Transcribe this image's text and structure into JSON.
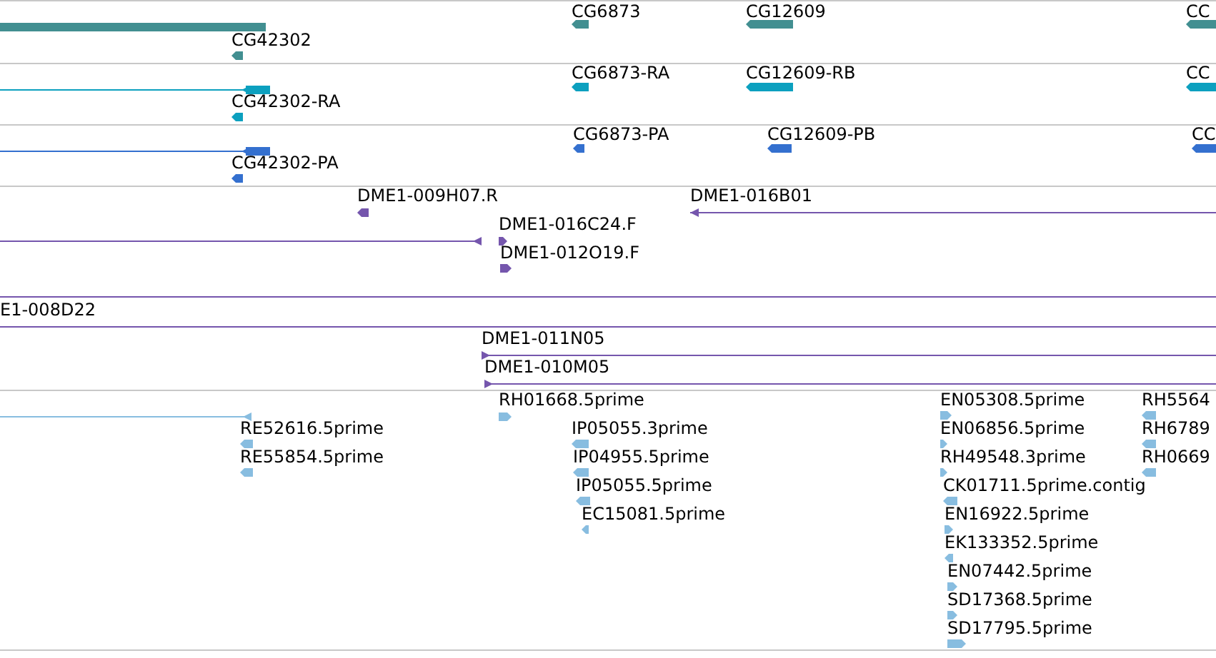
{
  "tracks": [
    {
      "color": "#428f91",
      "features": [
        {
          "kind": "bar"
        },
        {
          "kind": "bar",
          "label": "CG42302",
          "reverse": true
        },
        {
          "kind": "bar",
          "label": "CG6873",
          "reverse": true
        },
        {
          "kind": "bar",
          "label": "CG12609",
          "reverse": true
        },
        {
          "kind": "bar",
          "label": "CC",
          "reverse": true
        }
      ]
    },
    {
      "color": "#0ca0bf",
      "features": [
        {
          "kind": "gene",
          "reverse": true
        },
        {
          "kind": "bar",
          "label": "CG42302-RA",
          "reverse": true
        },
        {
          "kind": "bar",
          "label": "CG6873-RA",
          "reverse": true
        },
        {
          "kind": "bar",
          "label": "CG12609-RB",
          "reverse": true
        },
        {
          "kind": "bar",
          "label": "CC",
          "reverse": true
        }
      ]
    },
    {
      "color": "#3470cf",
      "features": [
        {
          "kind": "gene",
          "reverse": true
        },
        {
          "kind": "bar",
          "label": "CG42302-PA",
          "reverse": true
        },
        {
          "kind": "bar",
          "label": "CG6873-PA",
          "reverse": true
        },
        {
          "kind": "bar",
          "label": "CG12609-PB",
          "reverse": true
        },
        {
          "kind": "bar",
          "label": "CC",
          "reverse": true
        }
      ]
    },
    {
      "color": "#7556ad",
      "features": [
        {
          "kind": "bar",
          "label": "DME1-009H07.R",
          "reverse": true
        },
        {
          "kind": "line",
          "label": "DME1-016B01",
          "reverse": true
        },
        {
          "kind": "line",
          "reverse": true
        },
        {
          "kind": "bar",
          "label": "DME1-016C24.F",
          "reverse": false
        },
        {
          "kind": "bar",
          "label": "DME1-012O19.F",
          "reverse": false
        },
        {
          "kind": "line"
        },
        {
          "kind": "line",
          "label": "E1-008D22"
        },
        {
          "kind": "line",
          "label": "DME1-011N05",
          "reverse": false
        },
        {
          "kind": "line",
          "label": "DME1-010M05",
          "reverse": false
        }
      ]
    },
    {
      "color": "#88bde0",
      "features": [
        {
          "kind": "line",
          "reverse": true
        },
        {
          "kind": "bar",
          "label": "RE52616.5prime",
          "reverse": true
        },
        {
          "kind": "bar",
          "label": "RE55854.5prime",
          "reverse": true
        },
        {
          "kind": "bar",
          "label": "RH01668.5prime",
          "reverse": false
        },
        {
          "kind": "bar",
          "label": "IP05055.3prime",
          "reverse": true
        },
        {
          "kind": "bar",
          "label": "IP04955.5prime",
          "reverse": true
        },
        {
          "kind": "bar",
          "label": "IP05055.5prime",
          "reverse": true
        },
        {
          "kind": "bar",
          "label": "EC15081.5prime",
          "reverse": true
        },
        {
          "kind": "bar",
          "label": "EN05308.5prime",
          "reverse": false
        },
        {
          "kind": "bar",
          "label": "EN06856.5prime",
          "reverse": false
        },
        {
          "kind": "bar",
          "label": "RH49548.3prime",
          "reverse": false
        },
        {
          "kind": "bar",
          "label": "CK01711.5prime.contig",
          "reverse": true
        },
        {
          "kind": "bar",
          "label": "EN16922.5prime",
          "reverse": false
        },
        {
          "kind": "bar",
          "label": "EK133352.5prime",
          "reverse": true
        },
        {
          "kind": "bar",
          "label": "EN07442.5prime",
          "reverse": false
        },
        {
          "kind": "bar",
          "label": "SD17368.5prime",
          "reverse": false
        },
        {
          "kind": "bar",
          "label": "SD17795.5prime",
          "reverse": false
        },
        {
          "kind": "bar",
          "label": "RH5564",
          "reverse": true
        },
        {
          "kind": "bar",
          "label": "RH6789",
          "reverse": true
        },
        {
          "kind": "bar",
          "label": "RH0669",
          "reverse": true
        }
      ]
    }
  ]
}
